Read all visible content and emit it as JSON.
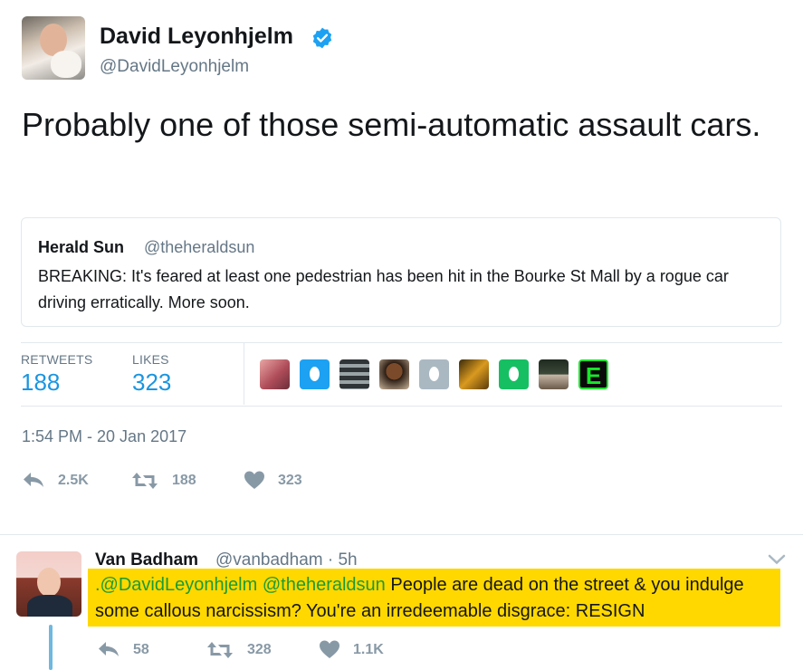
{
  "tweet": {
    "author_name": "David Leyonhjelm",
    "author_handle": "@DavidLeyonhjelm",
    "text": "Probably one of those semi-automatic assault cars.",
    "timestamp": "1:54 PM - 20 Jan 2017",
    "quoted": {
      "name": "Herald Sun",
      "handle": "@theheraldsun",
      "text": "BREAKING: It's feared at least one pedestrian has been hit in the Bourke St Mall by a rogue car driving erratically. More soon."
    },
    "stats": {
      "retweets_label": "RETWEETS",
      "retweets_value": "188",
      "likes_label": "LIKES",
      "likes_value": "323"
    },
    "actions": {
      "reply_count": "2.5K",
      "retweet_count": "188",
      "like_count": "323"
    },
    "liker_avatars": [
      "photo",
      "egg-blue",
      "photo",
      "photo",
      "egg-gray",
      "photo",
      "egg-green",
      "photo",
      "letter-e"
    ],
    "liker_letter": "E"
  },
  "reply": {
    "author_name": "Van Badham",
    "author_handle": "@vanbadham",
    "time": "· 5h",
    "mention_1": ".@DavidLeyonhjelm",
    "mention_2": "@theheraldsun",
    "text": " People are dead on the street & you indulge some callous narcissism? You're an irredeemable disgrace: RESIGN",
    "actions": {
      "reply_count": "58",
      "retweet_count": "328",
      "like_count": "1.1K"
    }
  },
  "colors": {
    "accent": "#1b95e0",
    "muted": "#657786",
    "highlight": "#ffd800",
    "mention": "#1b9b34"
  }
}
